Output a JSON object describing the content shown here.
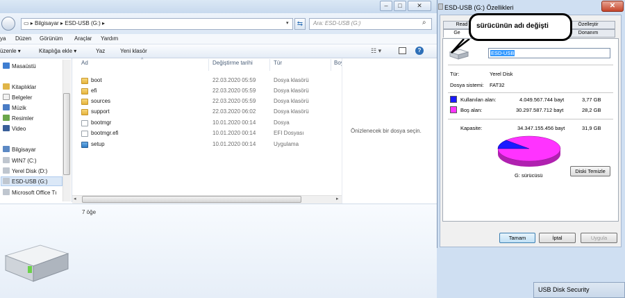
{
  "explorer": {
    "breadcrumb": [
      "Bilgisayar",
      "ESD-USB (G:)"
    ],
    "search_placeholder": "Ara: ESD-USB (G:)",
    "menu": [
      "ya",
      "Düzen",
      "Görünüm",
      "Araçlar",
      "Yardım"
    ],
    "toolbar": [
      "üzenle ▾",
      "Kitaplığa ekle ▾",
      "Yaz",
      "Yeni klasör"
    ],
    "nav": [
      {
        "label": "Masaüstü",
        "icon": "desktop-icon"
      },
      {
        "label": "Kitaplıklar",
        "icon": "library-icon"
      },
      {
        "label": "Belgeler",
        "icon": "documents-icon"
      },
      {
        "label": "Müzik",
        "icon": "music-icon"
      },
      {
        "label": "Resimler",
        "icon": "pictures-icon"
      },
      {
        "label": "Video",
        "icon": "video-icon"
      },
      {
        "label": "Bilgisayar",
        "icon": "computer-icon"
      },
      {
        "label": "WIN7 (C:)",
        "icon": "drive-icon"
      },
      {
        "label": "Yerel Disk (D:)",
        "icon": "drive-icon"
      },
      {
        "label": "ESD-USB (G:)",
        "icon": "usb-drive-icon"
      },
      {
        "label": "Microsoft Office Tı",
        "icon": "drive-icon"
      }
    ],
    "columns": {
      "name": "Ad",
      "date": "Değiştirme tarihi",
      "type": "Tür",
      "size": "Boy"
    },
    "files": [
      {
        "name": "boot",
        "date": "22.03.2020 05:59",
        "type": "Dosya klasörü",
        "icon": "folder-icon"
      },
      {
        "name": "efi",
        "date": "22.03.2020 05:59",
        "type": "Dosya klasörü",
        "icon": "folder-icon"
      },
      {
        "name": "sources",
        "date": "22.03.2020 05:59",
        "type": "Dosya klasörü",
        "icon": "folder-icon"
      },
      {
        "name": "support",
        "date": "22.03.2020 06:02",
        "type": "Dosya klasörü",
        "icon": "folder-icon"
      },
      {
        "name": "bootmgr",
        "date": "10.01.2020 00:14",
        "type": "Dosya",
        "icon": "file-icon"
      },
      {
        "name": "bootmgr.efi",
        "date": "10.01.2020 00:14",
        "type": "EFI Dosyası",
        "icon": "file-icon"
      },
      {
        "name": "setup",
        "date": "10.01.2020 00:14",
        "type": "Uygulama",
        "icon": "setup-icon"
      }
    ],
    "preview_text": "Önizlenecek bir dosya seçin.",
    "item_count": "7 öğe"
  },
  "props": {
    "title": "ESD-USB (G:) Özellikleri",
    "tabs_row1": [
      "Read",
      "Özelleştir"
    ],
    "tabs_row2": [
      "Ge",
      "Donanım"
    ],
    "name_value": "ESD-USB",
    "type_label": "Tür:",
    "type_value": "Yerel Disk",
    "fs_label": "Dosya sistemi:",
    "fs_value": "FAT32",
    "used_label": "Kullanılan alan:",
    "used_bytes": "4.049.567.744 bayt",
    "used_gb": "3,77 GB",
    "free_label": "Boş alan:",
    "free_bytes": "30.297.587.712 bayt",
    "free_gb": "28,2 GB",
    "cap_label": "Kapasite:",
    "cap_bytes": "34.347.155.456 bayt",
    "cap_gb": "31,9 GB",
    "drive_label": "G: sürücüsü",
    "cleanup_label": "Diski Temizle",
    "ok_label": "Tamam",
    "cancel_label": "İptal",
    "apply_label": "Uygula",
    "used_fraction": 0.118,
    "used_color": "#1a1aff",
    "free_color": "#ff33ff"
  },
  "callout": "sürücünün adı değişti",
  "usb_security": "USB Disk Security"
}
